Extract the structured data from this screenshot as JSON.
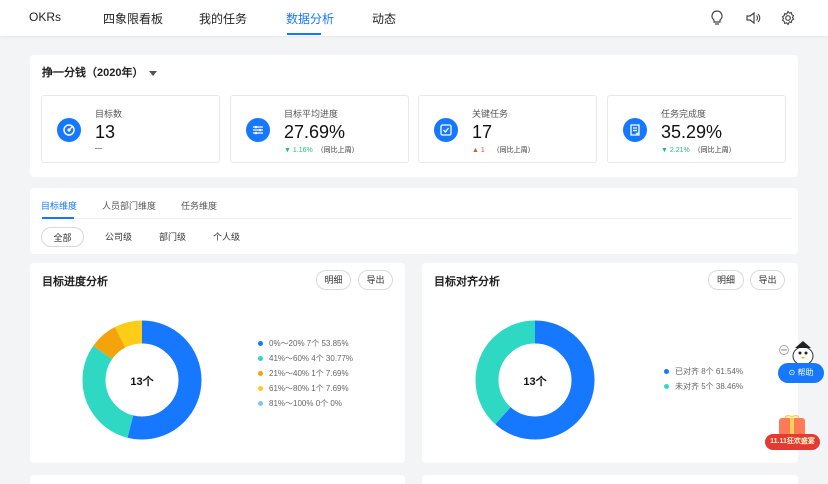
{
  "nav": {
    "items": [
      {
        "label": "OKRs",
        "active": false
      },
      {
        "label": "四象限看板",
        "active": false
      },
      {
        "label": "我的任务",
        "active": false
      },
      {
        "label": "数据分析",
        "active": true
      },
      {
        "label": "动态",
        "active": false
      }
    ],
    "icons": [
      "lightbulb-icon",
      "speaker-icon",
      "gear-icon"
    ]
  },
  "period": {
    "label": "挣一分钱（2020年）"
  },
  "stats": [
    {
      "icon": "target-icon",
      "label": "目标数",
      "value": "13",
      "change": "",
      "change_dir": "none",
      "note": "—"
    },
    {
      "icon": "sliders-icon",
      "label": "目标平均进度",
      "value": "27.69%",
      "change": "1.16%",
      "change_dir": "down",
      "note": "（同比上周）"
    },
    {
      "icon": "check-square-icon",
      "label": "关键任务",
      "value": "17",
      "change": "1",
      "change_dir": "up",
      "note": "（同比上周）"
    },
    {
      "icon": "document-check-icon",
      "label": "任务完成度",
      "value": "35.29%",
      "change": "2.21%",
      "change_dir": "down",
      "note": "（同比上周）"
    }
  ],
  "tabs": [
    {
      "label": "目标维度",
      "active": true
    },
    {
      "label": "人员部门维度",
      "active": false
    },
    {
      "label": "任务维度",
      "active": false
    }
  ],
  "filters": [
    {
      "label": "全部",
      "active": true
    },
    {
      "label": "公司级",
      "active": false
    },
    {
      "label": "部门级",
      "active": false
    },
    {
      "label": "个人级",
      "active": false
    }
  ],
  "panels": {
    "progress": {
      "title": "目标进度分析",
      "detail_label": "明细",
      "export_label": "导出",
      "center_label": "13个",
      "chart_data": {
        "type": "pie",
        "total": 13,
        "slices": [
          {
            "label": "0%～20%",
            "count": 7,
            "percent": 53.85,
            "color": "#1677ff"
          },
          {
            "label": "41%～60%",
            "count": 4,
            "percent": 30.77,
            "color": "#2ed8c3"
          },
          {
            "label": "21%～40%",
            "count": 1,
            "percent": 7.69,
            "color": "#f5a30b"
          },
          {
            "label": "61%～80%",
            "count": 1,
            "percent": 7.69,
            "color": "#ffcc17"
          },
          {
            "label": "81%～100%",
            "count": 0,
            "percent": 0,
            "color": "#7ec7f0"
          }
        ],
        "legend_text": [
          "0%～20% 7个 53.85%",
          "41%～60% 4个 30.77%",
          "21%～40% 1个 7.69%",
          "61%～80% 1个 7.69%",
          "81%～100% 0个 0%"
        ]
      }
    },
    "alignment": {
      "title": "目标对齐分析",
      "detail_label": "明细",
      "export_label": "导出",
      "center_label": "13个",
      "chart_data": {
        "type": "pie",
        "total": 13,
        "slices": [
          {
            "label": "已对齐",
            "count": 8,
            "percent": 61.54,
            "color": "#1677ff"
          },
          {
            "label": "未对齐",
            "count": 5,
            "percent": 38.46,
            "color": "#2ed8c3"
          }
        ],
        "legend_text": [
          "已对齐 8个 61.54%",
          "未对齐 5个 38.46%"
        ]
      }
    }
  },
  "help": {
    "label": "⊙ 帮助"
  },
  "promo": {
    "label": "11.11狂欢盛宴"
  }
}
